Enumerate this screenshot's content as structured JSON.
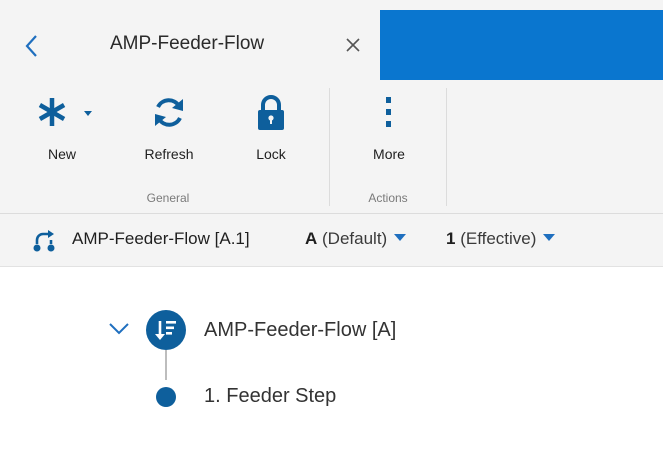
{
  "tab": {
    "title": "AMP-Feeder-Flow"
  },
  "ribbon": {
    "groups": [
      {
        "label": "General",
        "buttons": [
          {
            "label": "New",
            "icon": "asterisk-dropdown-icon"
          },
          {
            "label": "Refresh",
            "icon": "refresh-icon"
          },
          {
            "label": "Lock",
            "icon": "lock-icon"
          }
        ]
      },
      {
        "label": "Actions",
        "buttons": [
          {
            "label": "More",
            "icon": "vertical-ellipsis-icon"
          }
        ]
      }
    ]
  },
  "context": {
    "name": "AMP-Feeder-Flow [A.1]",
    "revision": {
      "value": "A",
      "note": "(Default)"
    },
    "sequence": {
      "value": "1",
      "note": "(Effective)"
    }
  },
  "tree": {
    "root": {
      "label": "AMP-Feeder-Flow [A]",
      "expanded": true
    },
    "children": [
      {
        "label": "1. Feeder Step"
      }
    ]
  },
  "colors": {
    "accent": "#0a76cf",
    "node": "#0e5f9c",
    "icon_blue": "#0e5f9c",
    "caret": "#1f6fbf"
  }
}
